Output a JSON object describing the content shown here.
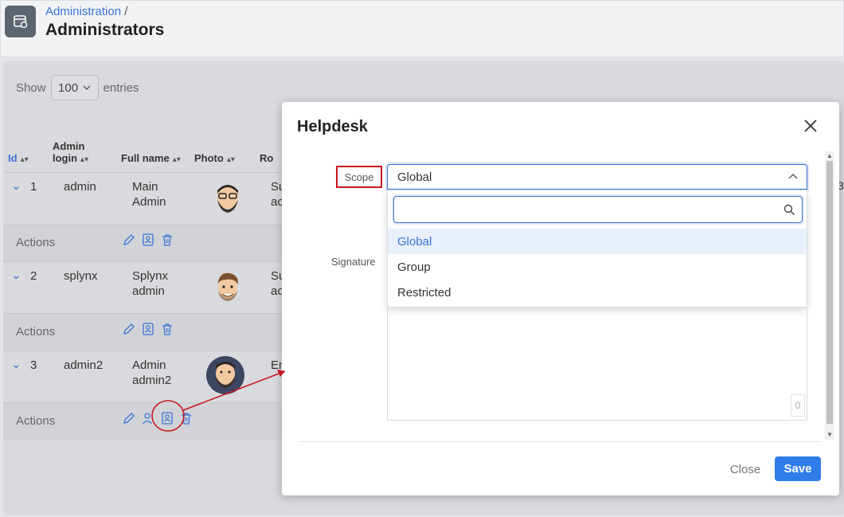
{
  "header": {
    "breadcrumb_parent": "Administration",
    "breadcrumb_sep": "/",
    "title": "Administrators"
  },
  "toolbar": {
    "show_label": "Show",
    "show_value": "100",
    "entries_label": "entries"
  },
  "table": {
    "columns": [
      "Id",
      "Admin login",
      "Full name",
      "Photo",
      "Ro"
    ],
    "rows": [
      {
        "id": "1",
        "login": "admin",
        "fullname_line1": "Main",
        "fullname_line2": "Admin",
        "role1": "Su",
        "role2": "ac",
        "actions_label": "Actions"
      },
      {
        "id": "2",
        "login": "splynx",
        "fullname_line1": "Splynx",
        "fullname_line2": "admin",
        "role1": "Su",
        "role2": "ac",
        "actions_label": "Actions"
      },
      {
        "id": "3",
        "login": "admin2",
        "fullname_line1": "Admin",
        "fullname_line2": "admin2",
        "role1": "En",
        "role2": "",
        "actions_label": "Actions"
      }
    ],
    "edge_digit": "3"
  },
  "modal": {
    "title": "Helpdesk",
    "scope_label": "Scope",
    "scope_value": "Global",
    "signature_label": "Signature",
    "search_placeholder": "",
    "options": [
      "Global",
      "Group",
      "Restricted"
    ],
    "selected_option": "Global",
    "char_counter": "0",
    "close_label": "Close",
    "save_label": "Save"
  },
  "colors": {
    "accent": "#3b73d6",
    "save_button": "#2f7de9",
    "annotation": "#c8171e"
  },
  "icons": {
    "app": "window-settings-icon",
    "close": "close-icon",
    "search": "search-icon",
    "chevron_up": "chevron-up-icon",
    "edit": "pencil-icon",
    "badge": "id-badge-icon",
    "delete": "trash-icon",
    "user": "user-icon"
  }
}
